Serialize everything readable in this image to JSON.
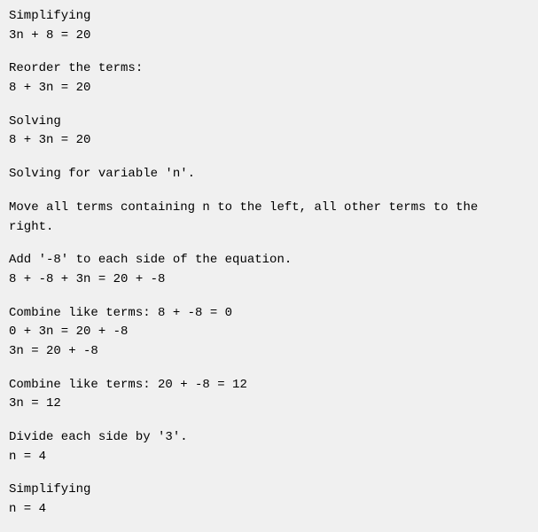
{
  "sections": [
    {
      "id": "simplifying-header",
      "lines": [
        "Simplifying",
        "3n + 8 = 20"
      ]
    },
    {
      "id": "reorder-terms",
      "lines": [
        "Reorder the terms:",
        "8 + 3n = 20"
      ]
    },
    {
      "id": "solving-header",
      "lines": [
        "Solving",
        "8 + 3n = 20"
      ]
    },
    {
      "id": "solving-for-variable",
      "lines": [
        "Solving for variable 'n'."
      ]
    },
    {
      "id": "move-all-terms",
      "lines": [
        "Move all terms containing n to the left, all other terms to the right."
      ]
    },
    {
      "id": "add-negative-8",
      "lines": [
        "Add '-8' to each side of the equation.",
        "8 + -8 + 3n = 20 + -8"
      ]
    },
    {
      "id": "combine-like-terms-1",
      "lines": [
        "Combine like terms: 8 + -8 = 0",
        "0 + 3n = 20 + -8",
        "3n = 20 + -8"
      ]
    },
    {
      "id": "combine-like-terms-2",
      "lines": [
        "Combine like terms: 20 + -8 = 12",
        "3n = 12"
      ]
    },
    {
      "id": "divide-each-side",
      "lines": [
        "Divide each side by '3'.",
        "n = 4"
      ]
    },
    {
      "id": "simplifying-footer",
      "lines": [
        "Simplifying",
        "n = 4"
      ]
    }
  ]
}
